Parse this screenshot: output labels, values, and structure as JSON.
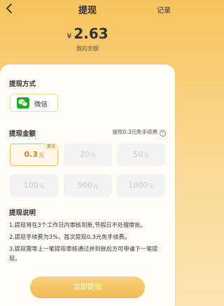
{
  "header": {
    "title": "提现",
    "record_label": "记录",
    "back_icon": "chevron-left-icon"
  },
  "balance": {
    "currency_symbol": "¥",
    "amount": "2.63",
    "label": "我的余额"
  },
  "method": {
    "section_title": "提现方式",
    "option_label": "微信",
    "option_icon": "wechat-icon"
  },
  "amount": {
    "section_title": "提现金额",
    "fee_note": "提现0.3元免手续费",
    "help_glyph": "?",
    "unit": "元",
    "first_badge": "首次",
    "options": [
      {
        "value": "0.3",
        "selected": true
      },
      {
        "value": "20",
        "selected": false
      },
      {
        "value": "50",
        "selected": false
      },
      {
        "value": "100",
        "selected": false
      },
      {
        "value": "500",
        "selected": false
      },
      {
        "value": "1000",
        "selected": false
      }
    ]
  },
  "notes": {
    "section_title": "提现说明",
    "lines": [
      "1.提现将在3个工作日内审核到账,节假日不处理审批。",
      "2.提现手续费为3%，首次提现0.3元免手续费。",
      "3.提现需等上一笔提现审核通过并到账后方可申请下一笔提现。"
    ]
  },
  "submit_label": "立即提现",
  "colors": {
    "accent": "#f6c25a",
    "selected_text": "#c7861a",
    "button": "#f2bb52",
    "wechat": "#1aad19"
  }
}
